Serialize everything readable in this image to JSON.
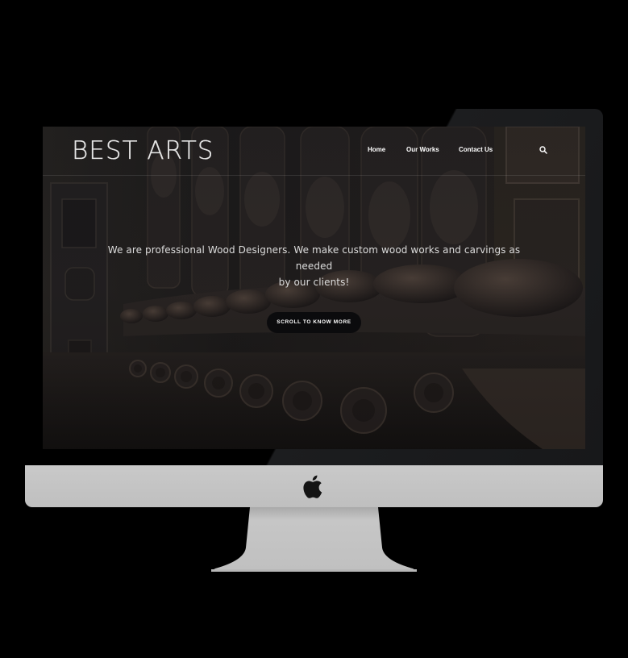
{
  "site": {
    "logo": "BEST ARTS",
    "nav": {
      "home": "Home",
      "our_works": "Our Works",
      "contact_us": "Contact Us"
    },
    "hero": {
      "tagline_line1": "We are professional Wood Designers. We make custom wood works and carvings as needed",
      "tagline_line2": "by our clients!",
      "cta_label": "SCROLL TO KNOW MORE"
    }
  },
  "icons": {
    "search": "search-icon",
    "apple": "apple-logo-icon"
  },
  "colors": {
    "page_background": "#000000",
    "bezel": "#050505",
    "chin": "#c4c4c4",
    "stand": "#c0c0c0",
    "cta_background": "#0b0b0d",
    "text": "#ffffff"
  }
}
